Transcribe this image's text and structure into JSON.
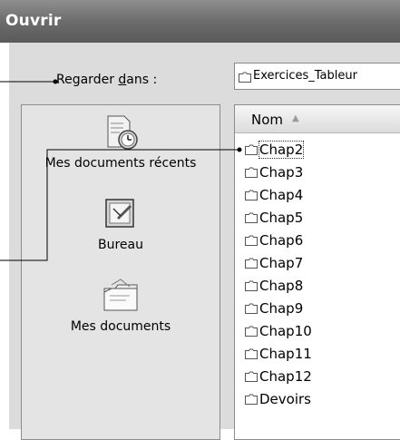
{
  "window": {
    "title": "Ouvrir"
  },
  "lookin": {
    "label_pre": "Regarder ",
    "label_u": "d",
    "label_post": "ans :",
    "value": "Exercices_Tableur"
  },
  "places": [
    {
      "label": "Mes documents récents",
      "icon": "recent-documents-icon"
    },
    {
      "label": "Bureau",
      "icon": "desktop-icon"
    },
    {
      "label": "Mes documents",
      "icon": "my-documents-icon"
    }
  ],
  "filelist": {
    "column_header": "Nom",
    "sort_indicator": "▲",
    "items": [
      "Chap2",
      "Chap3",
      "Chap4",
      "Chap5",
      "Chap6",
      "Chap7",
      "Chap8",
      "Chap9",
      "Chap10",
      "Chap11",
      "Chap12",
      "Devoirs"
    ],
    "selected": "Chap2"
  },
  "colors": {
    "titlebar": "#6c6c6c",
    "dialog_bg": "#dcdcdc",
    "callout_line": "#000000"
  }
}
